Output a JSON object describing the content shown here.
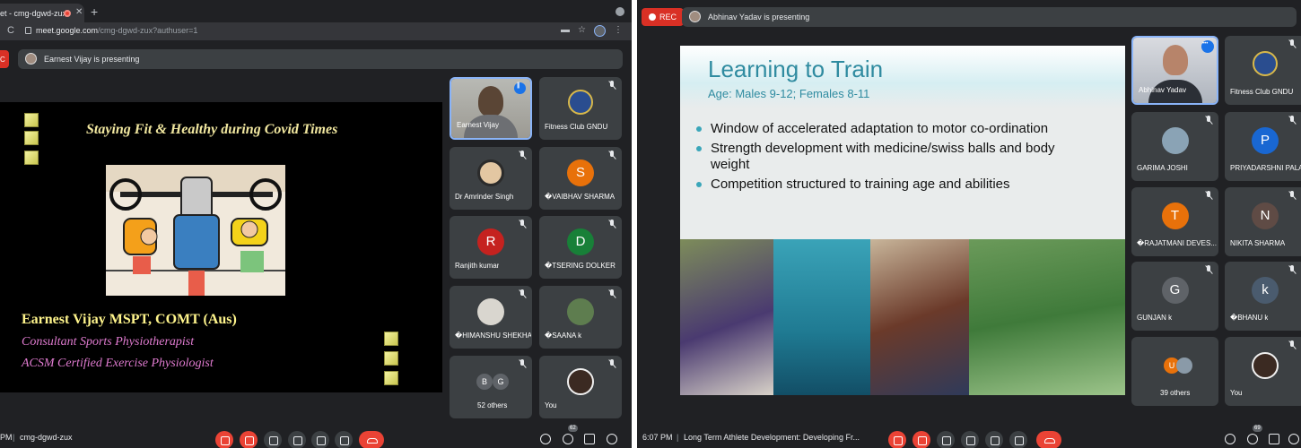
{
  "left": {
    "browser": {
      "tab_title": "et - cmg-dgwd-zux",
      "tab_close": "✕",
      "new_tab": "+",
      "reload": "C",
      "url_host": "meet.google.com",
      "url_path": "/cmg-dgwd-zux?authuser=1"
    },
    "presenting": "Earnest Vijay is presenting",
    "slide": {
      "title": "Staying Fit & Healthy during Covid Times",
      "name": "Earnest Vijay MSPT, COMT (Aus)",
      "role1": "Consultant Sports Physiotherapist",
      "role2": "ACSM Certified Exercise Physiologist"
    },
    "tiles": [
      {
        "name": "Earnest Vijay"
      },
      {
        "name": "Fitness Club GNDU"
      },
      {
        "name": "Dr Amrinder Singh"
      },
      {
        "name": "�VAIBHAV SHARMA",
        "initial": "S",
        "color": "#e8710a"
      },
      {
        "name": "Ranjith kumar",
        "initial": "R",
        "color": "#c5221f"
      },
      {
        "name": "�TSERING DOLKER",
        "initial": "D",
        "color": "#188038"
      },
      {
        "name": "�HIMANSHU SHEKHAR"
      },
      {
        "name": "�SAANA k"
      },
      {
        "name": "52 others",
        "a": "B",
        "b": "G"
      },
      {
        "name": "You"
      }
    ],
    "bottom": {
      "time": "PM",
      "meeting_code": "cmg-dgwd-zux",
      "people_count": "62"
    }
  },
  "right": {
    "rec_label": "REC",
    "presenting": "Abhinav Yadav is presenting",
    "slide": {
      "title": "Learning to Train",
      "subtitle": "Age: Males 9-12; Females 8-11",
      "bullets": [
        "Window of accelerated adaptation to motor co-ordination",
        "Strength development with medicine/swiss balls and body weight",
        "Competition structured to training age and abilities"
      ]
    },
    "tiles": [
      {
        "name": "Abhinav Yadav"
      },
      {
        "name": "Fitness Club GNDU"
      },
      {
        "name": "GARIMA JOSHI"
      },
      {
        "name": "PRIYADARSHNI PALAN",
        "initial": "P",
        "color": "#1967d2"
      },
      {
        "name": "�RAJATMANI DEVES...",
        "initial": "T",
        "color": "#e8710a"
      },
      {
        "name": "NIKITA SHARMA",
        "initial": "N",
        "color": "#5f4b45"
      },
      {
        "name": "GUNJAN k",
        "initial": "G",
        "color": "#5f6368"
      },
      {
        "name": "�BHANU k",
        "initial": "k",
        "color": "#4a5b6e"
      },
      {
        "name": "39 others",
        "a": "U"
      },
      {
        "name": "You"
      }
    ],
    "bottom": {
      "time": "6:07 PM",
      "meeting_title": "Long Term Athlete Development: Developing Fr...",
      "people_count": "69"
    }
  }
}
